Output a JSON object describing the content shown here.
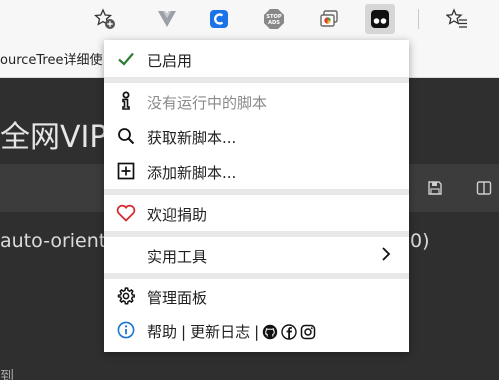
{
  "toolbar": {
    "icons": [
      "add-bookmark-icon",
      "vue-devtools-icon",
      "ccleaner-icon",
      "stop-ads-icon",
      "screenshot-icon",
      "tampermonkey-icon",
      "favorites-icon"
    ],
    "stop_ads_text": "STOP ADS"
  },
  "bookmarks": {
    "text": "ourceTree详细使"
  },
  "page": {
    "title": "全网VIP",
    "code_left": "auto-orient",
    "code_right": "0)",
    "footer": "到"
  },
  "menu": {
    "enabled_label": "已启用",
    "no_scripts_label": "没有运行中的脚本",
    "get_new_label": "获取新脚本...",
    "add_new_label": "添加新脚本...",
    "donate_label": "欢迎捐助",
    "utilities_label": "实用工具",
    "dashboard_label": "管理面板",
    "help_label": "帮助",
    "help_sep": "|",
    "changelog_label": "更新日志",
    "help_sep2": "|"
  },
  "colors": {
    "check": "#2e7d32",
    "heart": "#d32f2f",
    "info": "#1976d2",
    "ccleaner": "#1a73e8"
  }
}
